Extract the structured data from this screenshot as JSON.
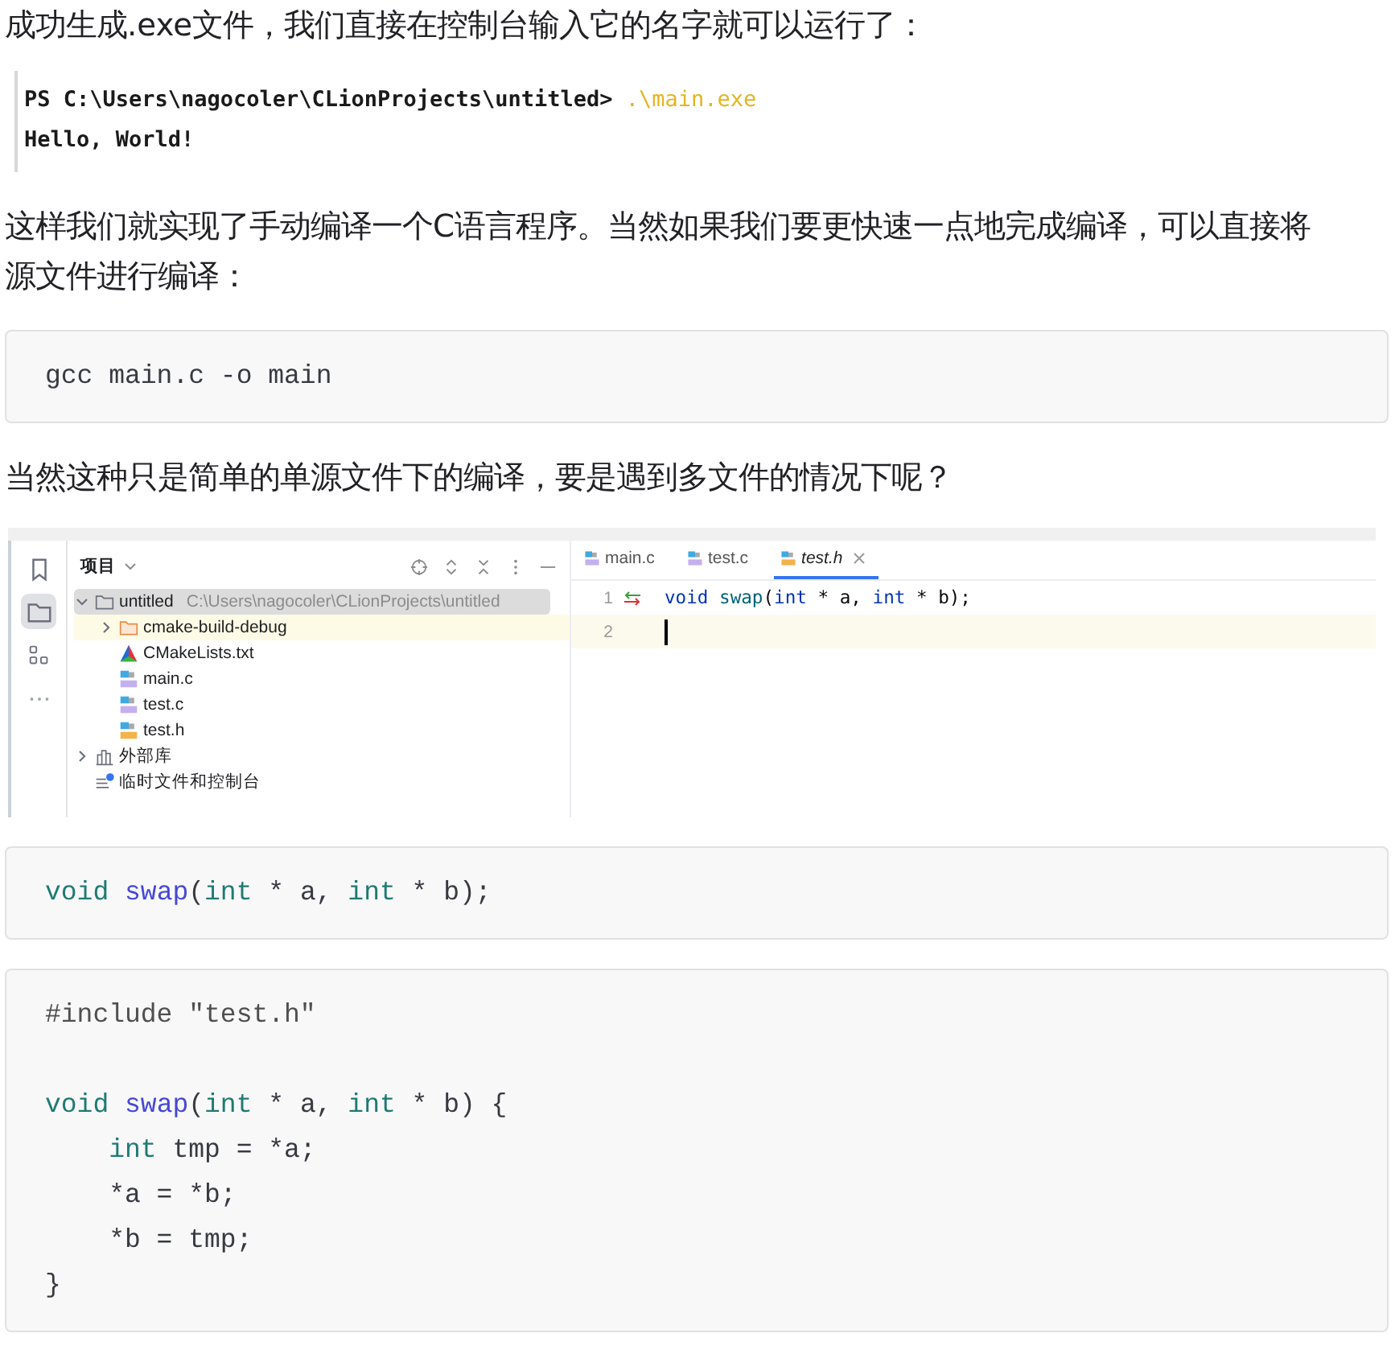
{
  "blocks": [
    {
      "kind": "paragraph",
      "text": "成功生成.exe文件，我们直接在控制台输入它的名字就可以运行了："
    },
    {
      "kind": "terminal",
      "prompt": "PS C:\\Users\\nagocoler\\CLionProjects\\untitled>",
      "command": ".\\main.exe",
      "output": "Hello, World!"
    },
    {
      "kind": "paragraph",
      "text": "这样我们就实现了手动编译一个C语言程序。当然如果我们要更快速一点地完成编译，可以直接将源文件进行编译："
    },
    {
      "kind": "code",
      "lines": [
        {
          "kind": "code",
          "tokens": [
            {
              "text": "gcc main.c -o main",
              "kind": "plain"
            }
          ]
        }
      ]
    },
    {
      "kind": "paragraph",
      "text": "当然这种只是简单的单源文件下的编译，要是遇到多文件的情况下呢？"
    },
    {
      "kind": "ide",
      "tool_buttons": [
        {
          "kind": "bookmark",
          "selected": false
        },
        {
          "kind": "folder",
          "selected": true
        },
        {
          "kind": "structure",
          "selected": false
        },
        {
          "kind": "more",
          "selected": false
        }
      ],
      "panel_title": "项目",
      "tree": [
        {
          "label": "untitled",
          "path": "C:\\Users\\nagocoler\\CLionProjects\\untitled",
          "kind": "folder",
          "expanded": true,
          "selected": true,
          "highlighted": false,
          "children": [
            {
              "label": "cmake-build-debug",
              "kind": "build-folder",
              "expanded": false,
              "selected": false,
              "highlighted": true
            },
            {
              "label": "CMakeLists.txt",
              "kind": "cmake",
              "selected": false,
              "highlighted": false
            },
            {
              "label": "main.c",
              "kind": "c-file",
              "selected": false,
              "highlighted": false
            },
            {
              "label": "test.c",
              "kind": "c-file",
              "selected": false,
              "highlighted": false
            },
            {
              "label": "test.h",
              "kind": "h-file",
              "selected": false,
              "highlighted": false
            }
          ]
        },
        {
          "label": "外部库",
          "kind": "library",
          "expanded": false,
          "selected": false,
          "highlighted": false
        },
        {
          "label": "临时文件和控制台",
          "kind": "scratches",
          "selected": false,
          "highlighted": false
        }
      ],
      "tabs": [
        {
          "label": "main.c",
          "kind": "c-file",
          "selected": false
        },
        {
          "label": "test.c",
          "kind": "c-file",
          "selected": false
        },
        {
          "label": "test.h",
          "kind": "h-file",
          "selected": true
        }
      ],
      "editor_lines": [
        {
          "number": "1",
          "gutter_icon": true,
          "current": false,
          "tokens": [
            {
              "text": "void ",
              "kind": "kw"
            },
            {
              "text": "swap",
              "kind": "fn"
            },
            {
              "text": "(",
              "kind": "plain"
            },
            {
              "text": "int",
              "kind": "kw"
            },
            {
              "text": " * a, ",
              "kind": "plain"
            },
            {
              "text": "int",
              "kind": "kw"
            },
            {
              "text": " * b);",
              "kind": "plain"
            }
          ]
        },
        {
          "number": "2",
          "gutter_icon": false,
          "current": true
        }
      ]
    },
    {
      "kind": "code",
      "lines": [
        {
          "kind": "code",
          "tokens": [
            {
              "text": "void ",
              "kind": "kw"
            },
            {
              "text": "swap",
              "kind": "fn"
            },
            {
              "text": "(",
              "kind": "plain"
            },
            {
              "text": "int",
              "kind": "kw"
            },
            {
              "text": " * a, ",
              "kind": "plain"
            },
            {
              "text": "int",
              "kind": "kw"
            },
            {
              "text": " * b);",
              "kind": "plain"
            }
          ]
        }
      ]
    },
    {
      "kind": "code",
      "lines": [
        {
          "kind": "code",
          "tokens": [
            {
              "text": "#include \"test.h\"",
              "kind": "meta"
            }
          ]
        },
        {
          "kind": "blank"
        },
        {
          "kind": "code",
          "tokens": [
            {
              "text": "void ",
              "kind": "kw"
            },
            {
              "text": "swap",
              "kind": "fn"
            },
            {
              "text": "(",
              "kind": "plain"
            },
            {
              "text": "int",
              "kind": "kw"
            },
            {
              "text": " * a, ",
              "kind": "plain"
            },
            {
              "text": "int",
              "kind": "kw"
            },
            {
              "text": " * b) {",
              "kind": "plain"
            }
          ]
        },
        {
          "kind": "code",
          "tokens": [
            {
              "text": "    int",
              "kind": "kw"
            },
            {
              "text": " tmp = *a;",
              "kind": "plain"
            }
          ]
        },
        {
          "kind": "code",
          "tokens": [
            {
              "text": "    *a = *b;",
              "kind": "plain"
            }
          ]
        },
        {
          "kind": "code",
          "tokens": [
            {
              "text": "    *b = tmp;",
              "kind": "plain"
            }
          ]
        },
        {
          "kind": "code",
          "tokens": [
            {
              "text": "}",
              "kind": "plain"
            }
          ]
        }
      ]
    }
  ]
}
